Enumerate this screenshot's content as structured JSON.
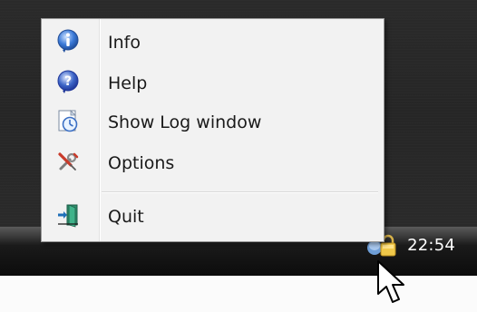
{
  "taskbar": {
    "clock": "22:54"
  },
  "menu": {
    "items": [
      {
        "label": "Info",
        "icon": "info-icon"
      },
      {
        "label": "Help",
        "icon": "help-icon"
      },
      {
        "label": "Show Log window",
        "icon": "log-window-icon"
      },
      {
        "label": "Options",
        "icon": "options-tools-icon"
      },
      {
        "label": "Quit",
        "icon": "quit-exit-icon"
      }
    ]
  },
  "colors": {
    "menu_bg": "#f2f2f2",
    "taskbar": "#0c0c0c",
    "desktop": "#262626"
  }
}
